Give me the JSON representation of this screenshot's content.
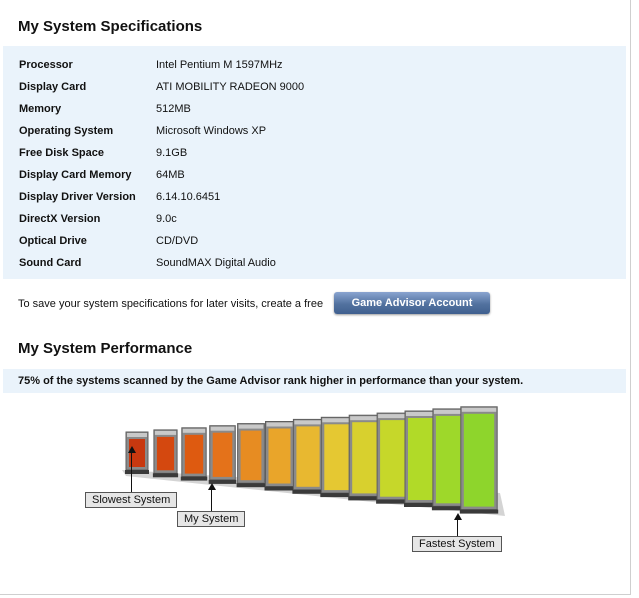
{
  "specs": {
    "title": "My System Specifications",
    "rows": [
      {
        "label": "Processor",
        "value": "Intel Pentium M 1597MHz"
      },
      {
        "label": "Display Card",
        "value": "ATI MOBILITY RADEON 9000"
      },
      {
        "label": "Memory",
        "value": "512MB"
      },
      {
        "label": "Operating System",
        "value": "Microsoft Windows XP"
      },
      {
        "label": "Free Disk Space",
        "value": "9.1GB"
      },
      {
        "label": "Display Card Memory",
        "value": "64MB"
      },
      {
        "label": "Display Driver Version",
        "value": "6.14.10.6451"
      },
      {
        "label": "DirectX Version",
        "value": "9.0c"
      },
      {
        "label": "Optical Drive",
        "value": "CD/DVD"
      },
      {
        "label": "Sound Card",
        "value": "SoundMAX Digital Audio"
      }
    ],
    "save_text": "To save your system specifications for later visits, create a free",
    "account_button": "Game Advisor Account"
  },
  "performance": {
    "title": "My System Performance",
    "summary": "75% of the systems scanned by the Game Advisor rank higher in performance than your system.",
    "bar_count": 13,
    "my_system_index": 3,
    "bar_colors": [
      "#c8380f",
      "#d4480f",
      "#de5a10",
      "#e4721a",
      "#e78c22",
      "#e9a52a",
      "#e8b830",
      "#e5c832",
      "#d8d02e",
      "#c6d72a",
      "#b1da28",
      "#9ed82a",
      "#8ed52c"
    ],
    "labels": {
      "slowest": "Slowest System",
      "mine": "My System",
      "fastest": "Fastest System"
    }
  }
}
